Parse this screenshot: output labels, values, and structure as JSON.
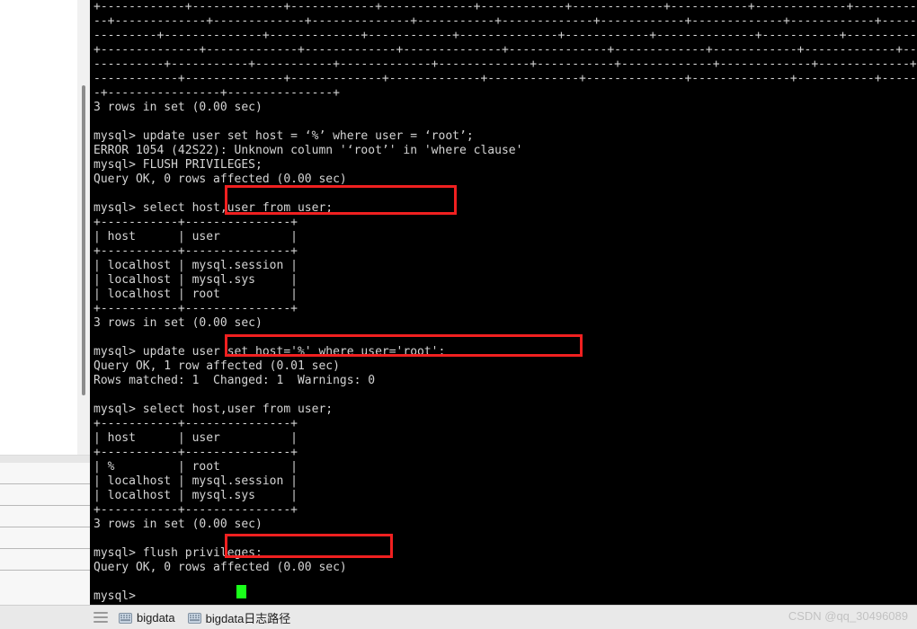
{
  "window": {
    "terminal_bg": "#000000",
    "terminal_fg": "#d4d4d4",
    "accent_red": "#f02020",
    "cursor_color": "#1aff1a"
  },
  "terminal": {
    "lines": [
      "+------------+-------------+------------+-------------+------------+-------------+-----------+-------------+------------+-------------+---",
      "--+-------------+-------------+--------------+-----------+-------------+------------+-------------+------------+------------+-------------",
      "---------+--------------+-------------+------------+--------------+------------+--------------+-----------+-------------+----------------",
      "+--------------+-------------+-------------+--------------+--------------+-------------+------------+-------------+--------------+--------",
      "----------+-----------+-----------+-------------+-------------+-----------+-------------+-------------+-------------+----------+---------",
      "------------+--------------+-------------+-------------+-------------+--------------+--------------+-----------+-------------+-----------",
      "-+----------------+---------------+",
      "3 rows in set (0.00 sec)",
      "",
      "mysql> update user set host = ‘%’ where user = ‘root’;",
      "ERROR 1054 (42S22): Unknown column '‘root’' in 'where clause'",
      "mysql> FLUSH PRIVILEGES;",
      "Query OK, 0 rows affected (0.00 sec)",
      "",
      "mysql> select host,user from user;",
      "+-----------+---------------+",
      "| host      | user          |",
      "+-----------+---------------+",
      "| localhost | mysql.session |",
      "| localhost | mysql.sys     |",
      "| localhost | root          |",
      "+-----------+---------------+",
      "3 rows in set (0.00 sec)",
      "",
      "mysql> update user set host='%' where user='root';",
      "Query OK, 1 row affected (0.01 sec)",
      "Rows matched: 1  Changed: 1  Warnings: 0",
      "",
      "mysql> select host,user from user;",
      "+-----------+---------------+",
      "| host      | user          |",
      "+-----------+---------------+",
      "| %         | root          |",
      "| localhost | mysql.session |",
      "| localhost | mysql.sys     |",
      "+-----------+---------------+",
      "3 rows in set (0.00 sec)",
      "",
      "mysql> flush privileges;",
      "Query OK, 0 rows affected (0.00 sec)",
      "",
      "mysql>"
    ]
  },
  "annotations": {
    "box1_label": "select host,user from user;",
    "box2_label": "update user set host='%' where user='root';",
    "box3_label": "flush privileges;"
  },
  "list_panel": {
    "rows": [
      "",
      "",
      "",
      "",
      "",
      ""
    ]
  },
  "taskbar": {
    "menu_icon": "hamburger-icon",
    "items": [
      {
        "icon": "terminal-icon",
        "label": "bigdata"
      },
      {
        "icon": "terminal-icon",
        "label": "bigdata日志路径"
      }
    ]
  },
  "watermark": {
    "text": "CSDN @qq_30496089"
  }
}
